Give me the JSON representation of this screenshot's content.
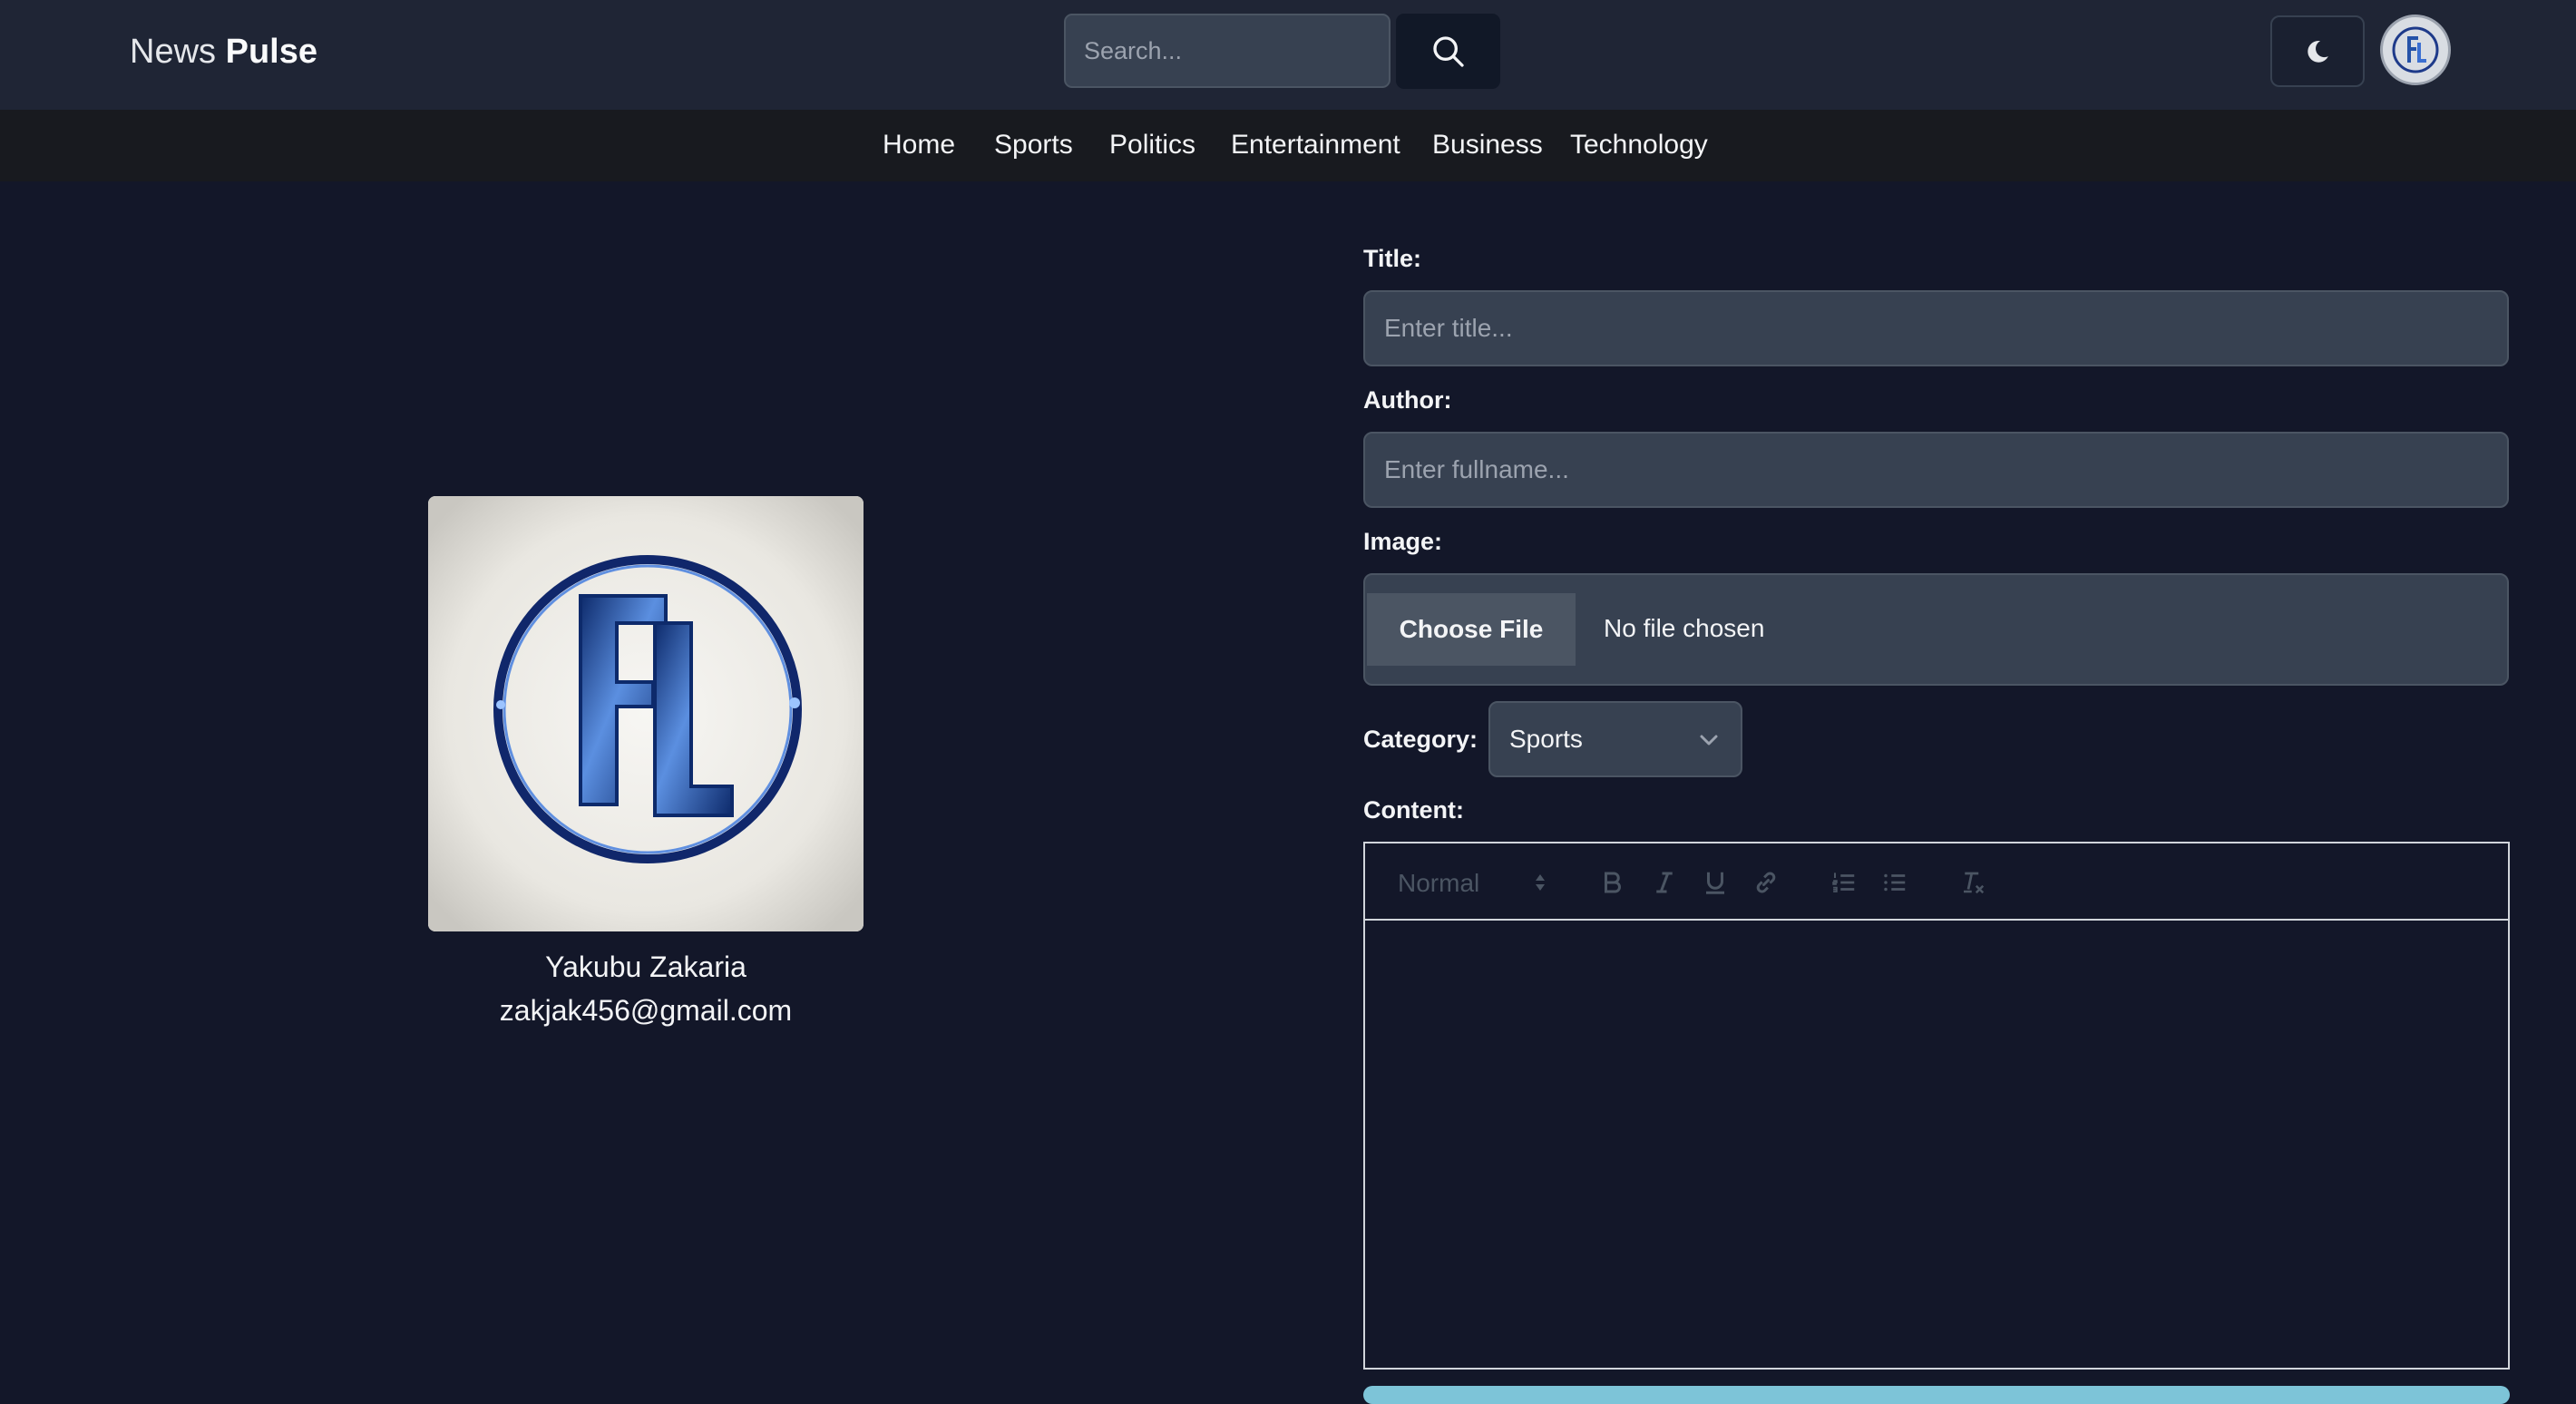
{
  "header": {
    "brand_prefix": "News",
    "brand_suffix": "Pulse",
    "search_placeholder": "Search..."
  },
  "nav": {
    "items": [
      "Home",
      "Sports",
      "Politics",
      "Entertainment",
      "Business",
      "Technology"
    ]
  },
  "profile": {
    "name": "Yakubu Zakaria",
    "email": "zakjak456@gmail.com"
  },
  "form": {
    "title_label": "Title:",
    "title_placeholder": "Enter title...",
    "author_label": "Author:",
    "author_placeholder": "Enter fullname...",
    "image_label": "Image:",
    "file_button": "Choose File",
    "file_status": "No file chosen",
    "category_label": "Category:",
    "category_value": "Sports",
    "content_label": "Content:",
    "editor": {
      "heading_value": "Normal",
      "toolbar_icons": [
        "bold-icon",
        "italic-icon",
        "underline-icon",
        "link-icon",
        "ordered-list-icon",
        "bullet-list-icon",
        "clear-format-icon"
      ]
    }
  },
  "colors": {
    "page_bg": "#131729",
    "header_bg": "#1f2535",
    "nav_bg": "#181a1f",
    "input_bg": "#374151",
    "submit_accent": "#7dc4d8"
  }
}
